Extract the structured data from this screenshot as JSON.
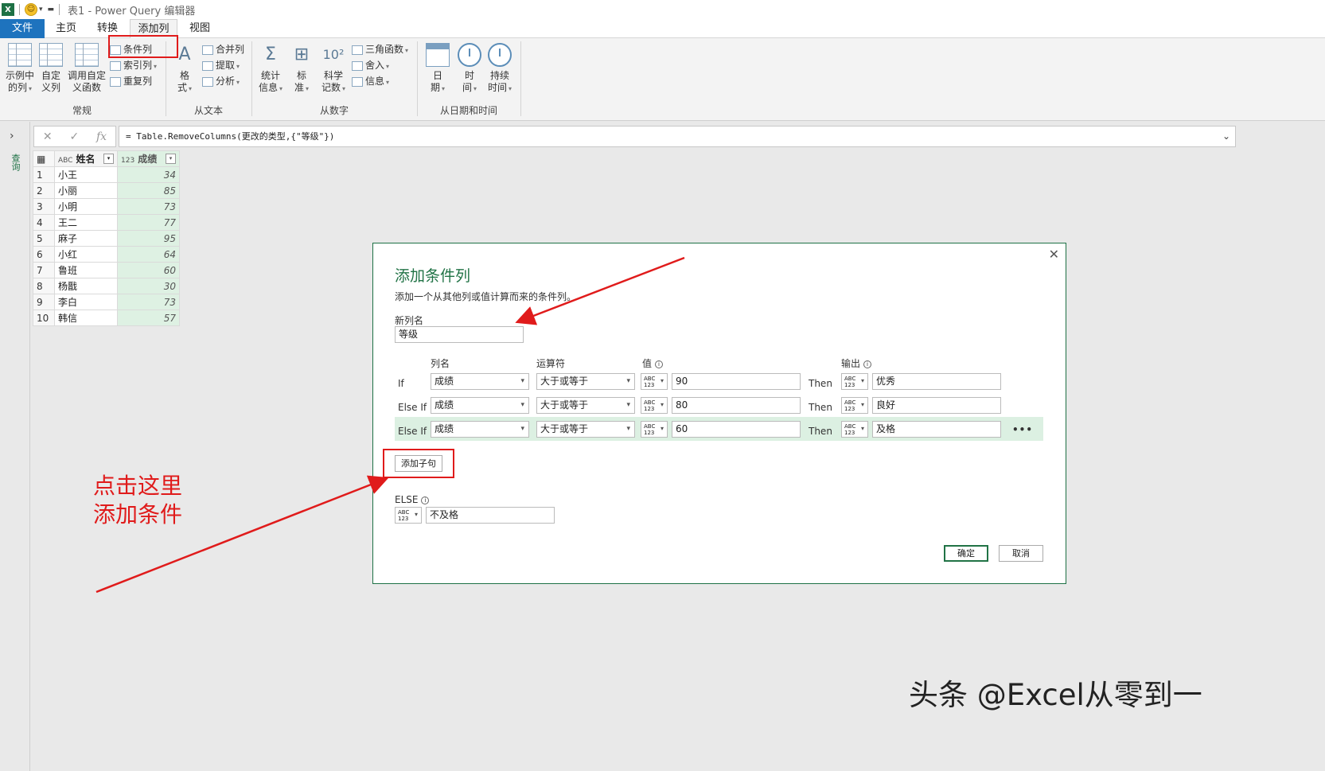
{
  "titlebar": {
    "app_icon": "X",
    "title": "表1 - Power Query 编辑器"
  },
  "tabs": [
    "文件",
    "主页",
    "转换",
    "添加列",
    "视图"
  ],
  "ribbon": {
    "general": {
      "group_label": "常规",
      "example_col": [
        "示例中",
        "的列"
      ],
      "custom_col": [
        "自定",
        "义列"
      ],
      "invoke_fn": [
        "调用自定",
        "义函数"
      ],
      "conditional_col": "条件列",
      "index_col": "索引列",
      "duplicate_col": "重复列"
    },
    "text": {
      "group_label": "从文本",
      "format": [
        "格",
        "式"
      ],
      "merge": "合并列",
      "extract": "提取",
      "parse": "分析"
    },
    "number": {
      "group_label": "从数字",
      "statistics": [
        "统计",
        "信息"
      ],
      "standard": [
        "标",
        "准"
      ],
      "scientific": [
        "科学",
        "记数"
      ],
      "trig": "三角函数",
      "rounding": "舍入",
      "info": "信息"
    },
    "datetime": {
      "group_label": "从日期和时间",
      "date": [
        "日",
        "期"
      ],
      "time": [
        "时",
        "间"
      ],
      "duration": [
        "持续",
        "时间"
      ]
    }
  },
  "leftpane": {
    "label": "查询"
  },
  "formula": "= Table.RemoveColumns(更改的类型,{\"等级\"})",
  "grid": {
    "headers": [
      "姓名",
      "成绩"
    ],
    "header_types": [
      "ABC",
      "123"
    ],
    "rows": [
      [
        "1",
        "小王",
        "34"
      ],
      [
        "2",
        "小丽",
        "85"
      ],
      [
        "3",
        "小明",
        "73"
      ],
      [
        "4",
        "王二",
        "77"
      ],
      [
        "5",
        "麻子",
        "95"
      ],
      [
        "6",
        "小红",
        "64"
      ],
      [
        "7",
        "鲁班",
        "60"
      ],
      [
        "8",
        "杨戬",
        "30"
      ],
      [
        "9",
        "李白",
        "73"
      ],
      [
        "10",
        "韩信",
        "57"
      ]
    ]
  },
  "dialog": {
    "title": "添加条件列",
    "description": "添加一个从其他列或值计算而来的条件列。",
    "new_col_label": "新列名",
    "new_col_value": "等级",
    "col_headers": {
      "column": "列名",
      "operator": "运算符",
      "value": "值",
      "output": "输出"
    },
    "type_badge": [
      "ABC",
      "123"
    ],
    "rules": [
      {
        "kw": "If",
        "column": "成绩",
        "operator": "大于或等于",
        "value": "90",
        "then": "Then",
        "output": "优秀"
      },
      {
        "kw": "Else If",
        "column": "成绩",
        "operator": "大于或等于",
        "value": "80",
        "then": "Then",
        "output": "良好"
      },
      {
        "kw": "Else If",
        "column": "成绩",
        "operator": "大于或等于",
        "value": "60",
        "then": "Then",
        "output": "及格"
      }
    ],
    "more": "•••",
    "add_clause": "添加子句",
    "else_label": "ELSE",
    "else_value": "不及格",
    "ok": "确定",
    "cancel": "取消"
  },
  "annotation": {
    "line1": "点击这里",
    "line2": "添加条件",
    "color": "#e01b1b"
  },
  "watermark": "头条 @Excel从零到一",
  "colors": {
    "accent": "#217346",
    "file_tab": "#1e73be",
    "highlight_row": "#dcf0e2"
  }
}
